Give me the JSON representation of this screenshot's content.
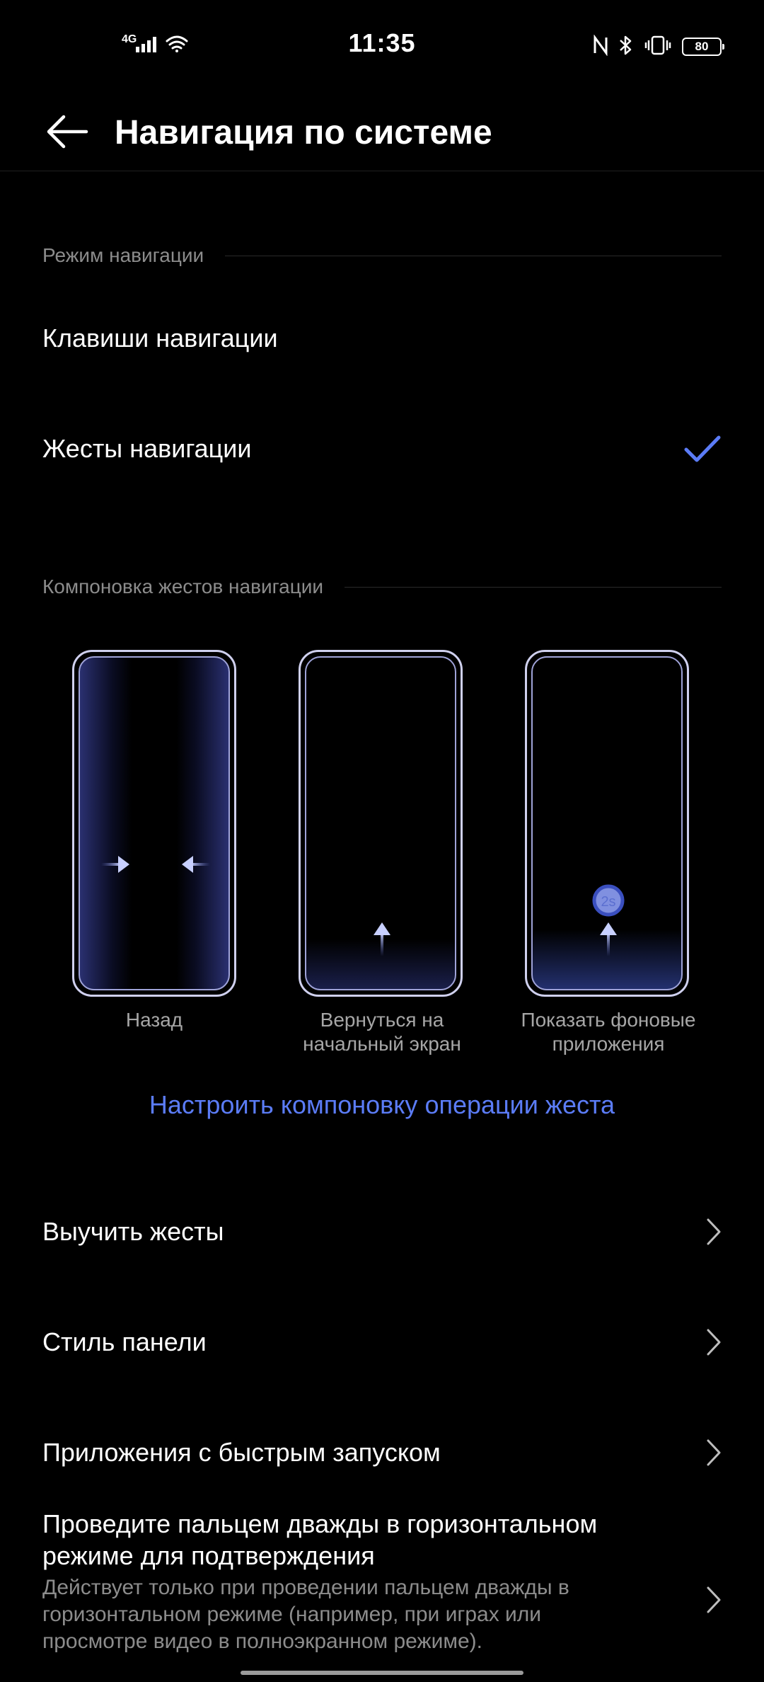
{
  "status_bar": {
    "network": "4G",
    "time": "11:35",
    "battery": "80"
  },
  "header": {
    "title": "Навигация по системе"
  },
  "sections": {
    "mode_header": "Режим навигации",
    "layout_header": "Компоновка жестов навигации"
  },
  "nav_modes": [
    {
      "label": "Клавиши навигации",
      "selected": false
    },
    {
      "label": "Жесты навигации",
      "selected": true
    }
  ],
  "gestures": [
    {
      "label": "Назад"
    },
    {
      "label": "Вернуться на начальный экран"
    },
    {
      "label": "Показать фоновые приложения",
      "badge": "2s"
    }
  ],
  "customize_link": "Настроить компоновку операции жеста",
  "menu": [
    {
      "label": "Выучить жесты"
    },
    {
      "label": "Стиль панели"
    },
    {
      "label": "Приложения с быстрым запуском"
    }
  ],
  "double_swipe": {
    "title": "Проведите пальцем дважды в горизонтальном режиме для подтверждения",
    "subtitle": "Действует только при проведении пальцем дважды в горизонтальном режиме (например, при играх или просмотре видео в полноэкранном режиме)."
  },
  "colors": {
    "accent": "#5b7cf7",
    "background": "#000000",
    "secondary_text": "#8c8c8c"
  }
}
